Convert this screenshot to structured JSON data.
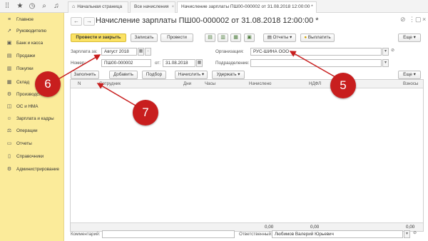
{
  "topbar": {
    "tabs": [
      {
        "label": "Начальная страница"
      },
      {
        "label": "Все начисления"
      },
      {
        "label": "Начисление зарплаты ПШ00-000002 от 31.08.2018 12:00:00 *"
      }
    ],
    "close_glyph": "×"
  },
  "sidebar": {
    "items": [
      {
        "label": "Главное",
        "icon": "≡"
      },
      {
        "label": "Руководителю",
        "icon": "↗"
      },
      {
        "label": "Банк и касса",
        "icon": "▣"
      },
      {
        "label": "Продажи",
        "icon": "▤"
      },
      {
        "label": "Покупки",
        "icon": "▥"
      },
      {
        "label": "Склад",
        "icon": "▦"
      },
      {
        "label": "Производство",
        "icon": "⚙"
      },
      {
        "label": "ОС и НМА",
        "icon": "◫"
      },
      {
        "label": "Зарплата и кадры",
        "icon": "☺"
      },
      {
        "label": "Операции",
        "icon": "⚖"
      },
      {
        "label": "Отчеты",
        "icon": "▭"
      },
      {
        "label": "Справочники",
        "icon": "▯"
      },
      {
        "label": "Администрирование",
        "icon": "⚙"
      }
    ]
  },
  "document": {
    "title": "Начисление зарплаты ПШ00-000002 от 31.08.2018 12:00:00 *",
    "toolbar": {
      "post_close": "Провести и закрыть",
      "save": "Записать",
      "post": "Провести",
      "reports": "Отчеты",
      "pay": "Выплатить",
      "more": "Еще"
    },
    "fields": {
      "salary_for_label": "Зарплата за:",
      "salary_for_value": "Август 2018",
      "number_label": "Номер:",
      "number_value": "ПШ00-000002",
      "date_label": "от:",
      "date_value": "31.08.2018",
      "org_label": "Организация:",
      "org_value": "РУС-ШИНА ООО",
      "dept_label": "Подразделение:",
      "dept_value": "",
      "comment_label": "Комментарий:",
      "comment_value": "",
      "responsible_label": "Ответственный:",
      "responsible_value": "Любимов Валерий Юрьевич"
    },
    "table_toolbar": {
      "fill": "Заполнить",
      "add": "Добавить",
      "select": "Подбор",
      "accrue": "Начислить",
      "withhold": "Удержать",
      "more": "Еще"
    },
    "table": {
      "columns": [
        "N",
        "Сотрудник",
        "Дни",
        "Часы",
        "Начислено",
        "НДФЛ",
        "Взносы"
      ],
      "totals": {
        "accrued": "0,00",
        "ndfl": "0,00",
        "contributions": "0,00"
      }
    }
  },
  "callouts": [
    {
      "number": "5"
    },
    {
      "number": "6"
    },
    {
      "number": "7"
    }
  ],
  "colors": {
    "sidebar_bg": "#fbeb9a",
    "primary_button": "#fbe264",
    "callout": "#c81e1e"
  }
}
